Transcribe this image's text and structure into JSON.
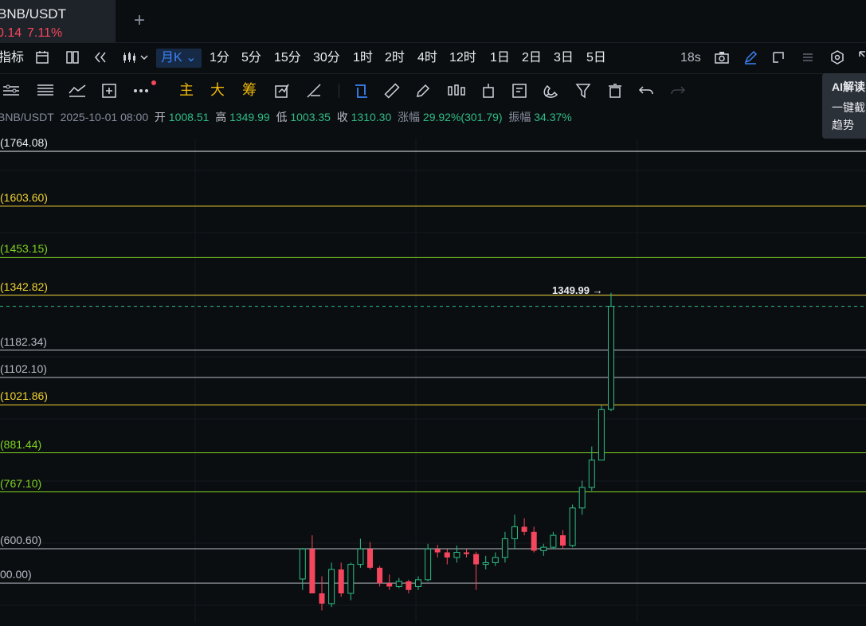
{
  "tab": {
    "title": "BNB/USDT",
    "price": "0.14",
    "change": "7.11%"
  },
  "toolbar": {
    "indicators_label": "指标",
    "period_active": "月K",
    "periods": [
      "1分",
      "5分",
      "15分",
      "30分",
      "1时",
      "2时",
      "4时",
      "12时",
      "1日",
      "2日",
      "3日",
      "5日"
    ],
    "countdown": "18s"
  },
  "toolbar2": {
    "main_label": "主",
    "large_label": "大",
    "chip_label": "筹"
  },
  "ohlc": {
    "symbol": "BNB/USDT",
    "date": "2025-10-01 08:00",
    "open_label": "开",
    "open": "1008.51",
    "high_label": "高",
    "high": "1349.99",
    "low_label": "低",
    "low": "1003.35",
    "close_label": "收",
    "close": "1310.30",
    "change_label": "涨幅",
    "change": "29.92%(301.79)",
    "amplitude_label": "振幅",
    "amplitude": "34.37%"
  },
  "ai_panel": {
    "title": "AI解读",
    "line1": "一键截",
    "line2": "趋势"
  },
  "fib_levels": [
    {
      "label": "(1764.08)",
      "value": 1764.08,
      "color": "#eaecef"
    },
    {
      "label": "(1603.60)",
      "value": 1603.6,
      "color": "#f0d332"
    },
    {
      "label": "(1453.15)",
      "value": 1453.15,
      "color": "#7ed321"
    },
    {
      "label": "(1342.82)",
      "value": 1342.82,
      "color": "#f0d332"
    },
    {
      "label": "(1182.34)",
      "value": 1182.34,
      "color": "#b7bdc6"
    },
    {
      "label": "(1102.10)",
      "value": 1102.1,
      "color": "#b7bdc6"
    },
    {
      "label": "(1021.86)",
      "value": 1021.86,
      "color": "#f0d332"
    },
    {
      "label": "(881.44)",
      "value": 881.44,
      "color": "#7ed321"
    },
    {
      "label": "(767.10)",
      "value": 767.1,
      "color": "#7ed321"
    },
    {
      "label": "(600.60)",
      "value": 600.6,
      "color": "#b7bdc6"
    },
    {
      "label": "00.00)",
      "value": 500.0,
      "color": "#b7bdc6"
    }
  ],
  "high_marker": "1349.99 →",
  "colors": {
    "up": "#2ebd85",
    "down": "#f6465d",
    "accent": "#3b82f6",
    "bg": "#0b0e11"
  },
  "chart_data": {
    "type": "candlestick",
    "last_candle": {
      "open": 1008.51,
      "high": 1349.99,
      "low": 1003.35,
      "close": 1310.3
    },
    "candles": [
      {
        "o": 512,
        "h": 603,
        "l": 480,
        "c": 600
      },
      {
        "o": 600,
        "h": 640,
        "l": 470,
        "c": 470
      },
      {
        "o": 470,
        "h": 520,
        "l": 420,
        "c": 440
      },
      {
        "o": 440,
        "h": 560,
        "l": 430,
        "c": 540
      },
      {
        "o": 540,
        "h": 560,
        "l": 460,
        "c": 470
      },
      {
        "o": 470,
        "h": 560,
        "l": 450,
        "c": 555
      },
      {
        "o": 555,
        "h": 630,
        "l": 545,
        "c": 600
      },
      {
        "o": 600,
        "h": 620,
        "l": 540,
        "c": 545
      },
      {
        "o": 545,
        "h": 550,
        "l": 490,
        "c": 500
      },
      {
        "o": 500,
        "h": 525,
        "l": 480,
        "c": 490
      },
      {
        "o": 490,
        "h": 515,
        "l": 485,
        "c": 505
      },
      {
        "o": 505,
        "h": 510,
        "l": 470,
        "c": 480
      },
      {
        "o": 490,
        "h": 520,
        "l": 480,
        "c": 510
      },
      {
        "o": 510,
        "h": 615,
        "l": 505,
        "c": 600
      },
      {
        "o": 600,
        "h": 612,
        "l": 575,
        "c": 590
      },
      {
        "o": 590,
        "h": 600,
        "l": 555,
        "c": 575
      },
      {
        "o": 575,
        "h": 610,
        "l": 560,
        "c": 590
      },
      {
        "o": 590,
        "h": 600,
        "l": 575,
        "c": 585
      },
      {
        "o": 585,
        "h": 592,
        "l": 480,
        "c": 555
      },
      {
        "o": 555,
        "h": 580,
        "l": 540,
        "c": 560
      },
      {
        "o": 560,
        "h": 590,
        "l": 550,
        "c": 575
      },
      {
        "o": 575,
        "h": 650,
        "l": 560,
        "c": 630
      },
      {
        "o": 630,
        "h": 700,
        "l": 600,
        "c": 665
      },
      {
        "o": 665,
        "h": 690,
        "l": 640,
        "c": 650
      },
      {
        "o": 650,
        "h": 665,
        "l": 590,
        "c": 595
      },
      {
        "o": 595,
        "h": 615,
        "l": 580,
        "c": 605
      },
      {
        "o": 605,
        "h": 650,
        "l": 600,
        "c": 640
      },
      {
        "o": 640,
        "h": 655,
        "l": 600,
        "c": 610
      },
      {
        "o": 610,
        "h": 730,
        "l": 605,
        "c": 720
      },
      {
        "o": 720,
        "h": 800,
        "l": 700,
        "c": 780
      },
      {
        "o": 780,
        "h": 900,
        "l": 770,
        "c": 860
      },
      {
        "o": 860,
        "h": 1020,
        "l": 860,
        "c": 1008
      },
      {
        "o": 1008.51,
        "h": 1349.99,
        "l": 1003.35,
        "c": 1310.3
      }
    ]
  }
}
